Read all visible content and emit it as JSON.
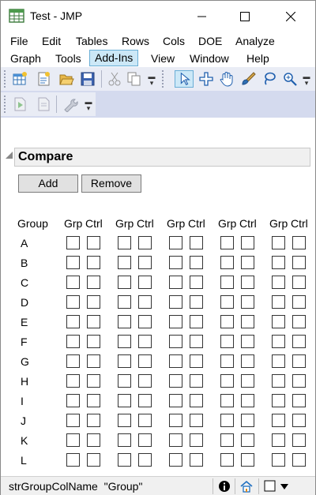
{
  "window": {
    "title": "Test - JMP",
    "minimize_glyph": "—",
    "maximize_glyph": "☐",
    "close_glyph": "✕"
  },
  "menus": {
    "row1": [
      "File",
      "Edit",
      "Tables",
      "Rows",
      "Cols",
      "DOE",
      "Analyze"
    ],
    "row2": [
      "Graph",
      "Tools",
      "Add-Ins",
      "View",
      "Window",
      "Help"
    ],
    "active": "Add-Ins"
  },
  "toolbar": {
    "icons": [
      "new-data-table-icon",
      "new-script-icon",
      "open-folder-icon",
      "save-icon",
      "cut-icon",
      "copy-icon",
      "arrow-cursor-icon",
      "crosshair-icon",
      "hand-icon",
      "brush-icon",
      "lasso-icon",
      "zoom-icon",
      "run-script-icon",
      "script-page-icon",
      "wrench-icon"
    ],
    "selected_tool": "arrow-cursor-icon"
  },
  "report": {
    "outline_title": "Compare",
    "add_label": "Add",
    "remove_label": "Remove",
    "group_header": "Group",
    "grp_header": "Grp",
    "ctrl_header": "Ctrl",
    "column_pairs": 5,
    "groups": [
      "A",
      "B",
      "C",
      "D",
      "E",
      "F",
      "G",
      "H",
      "I",
      "J",
      "K",
      "L"
    ]
  },
  "statusbar": {
    "text": "strGroupColName  \"Group\"",
    "icons": [
      "info-icon",
      "home-icon",
      "window-list-icon"
    ]
  }
}
